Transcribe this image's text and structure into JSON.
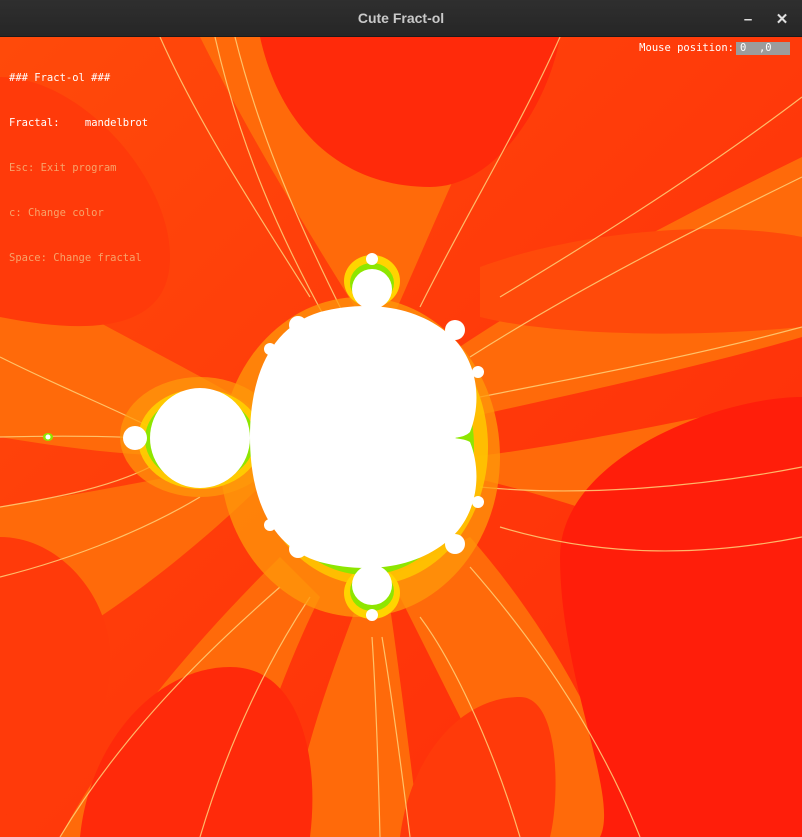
{
  "window": {
    "title": "Cute Fract-ol",
    "minimize_glyph": "–",
    "close_glyph": "✕"
  },
  "hud": {
    "header": "### Fract-ol ###",
    "fractal_label": "Fractal:",
    "fractal_name": "mandelbrot",
    "help_exit": "Esc: Exit program",
    "help_color": "c: Change color",
    "help_space": "Space: Change fractal",
    "mouse_label": "Mouse position:",
    "mouse_x": "0",
    "mouse_y": "0"
  },
  "icons": {
    "minimize": "minimize-icon",
    "close": "close-icon"
  },
  "colors": {
    "background_red": "#ff2a0a",
    "band_orange": "#ff5a0a",
    "band_light_orange": "#ff8a0a",
    "edge_yellow": "#ffd400",
    "edge_green": "#22e000",
    "set_white": "#ffffff"
  }
}
